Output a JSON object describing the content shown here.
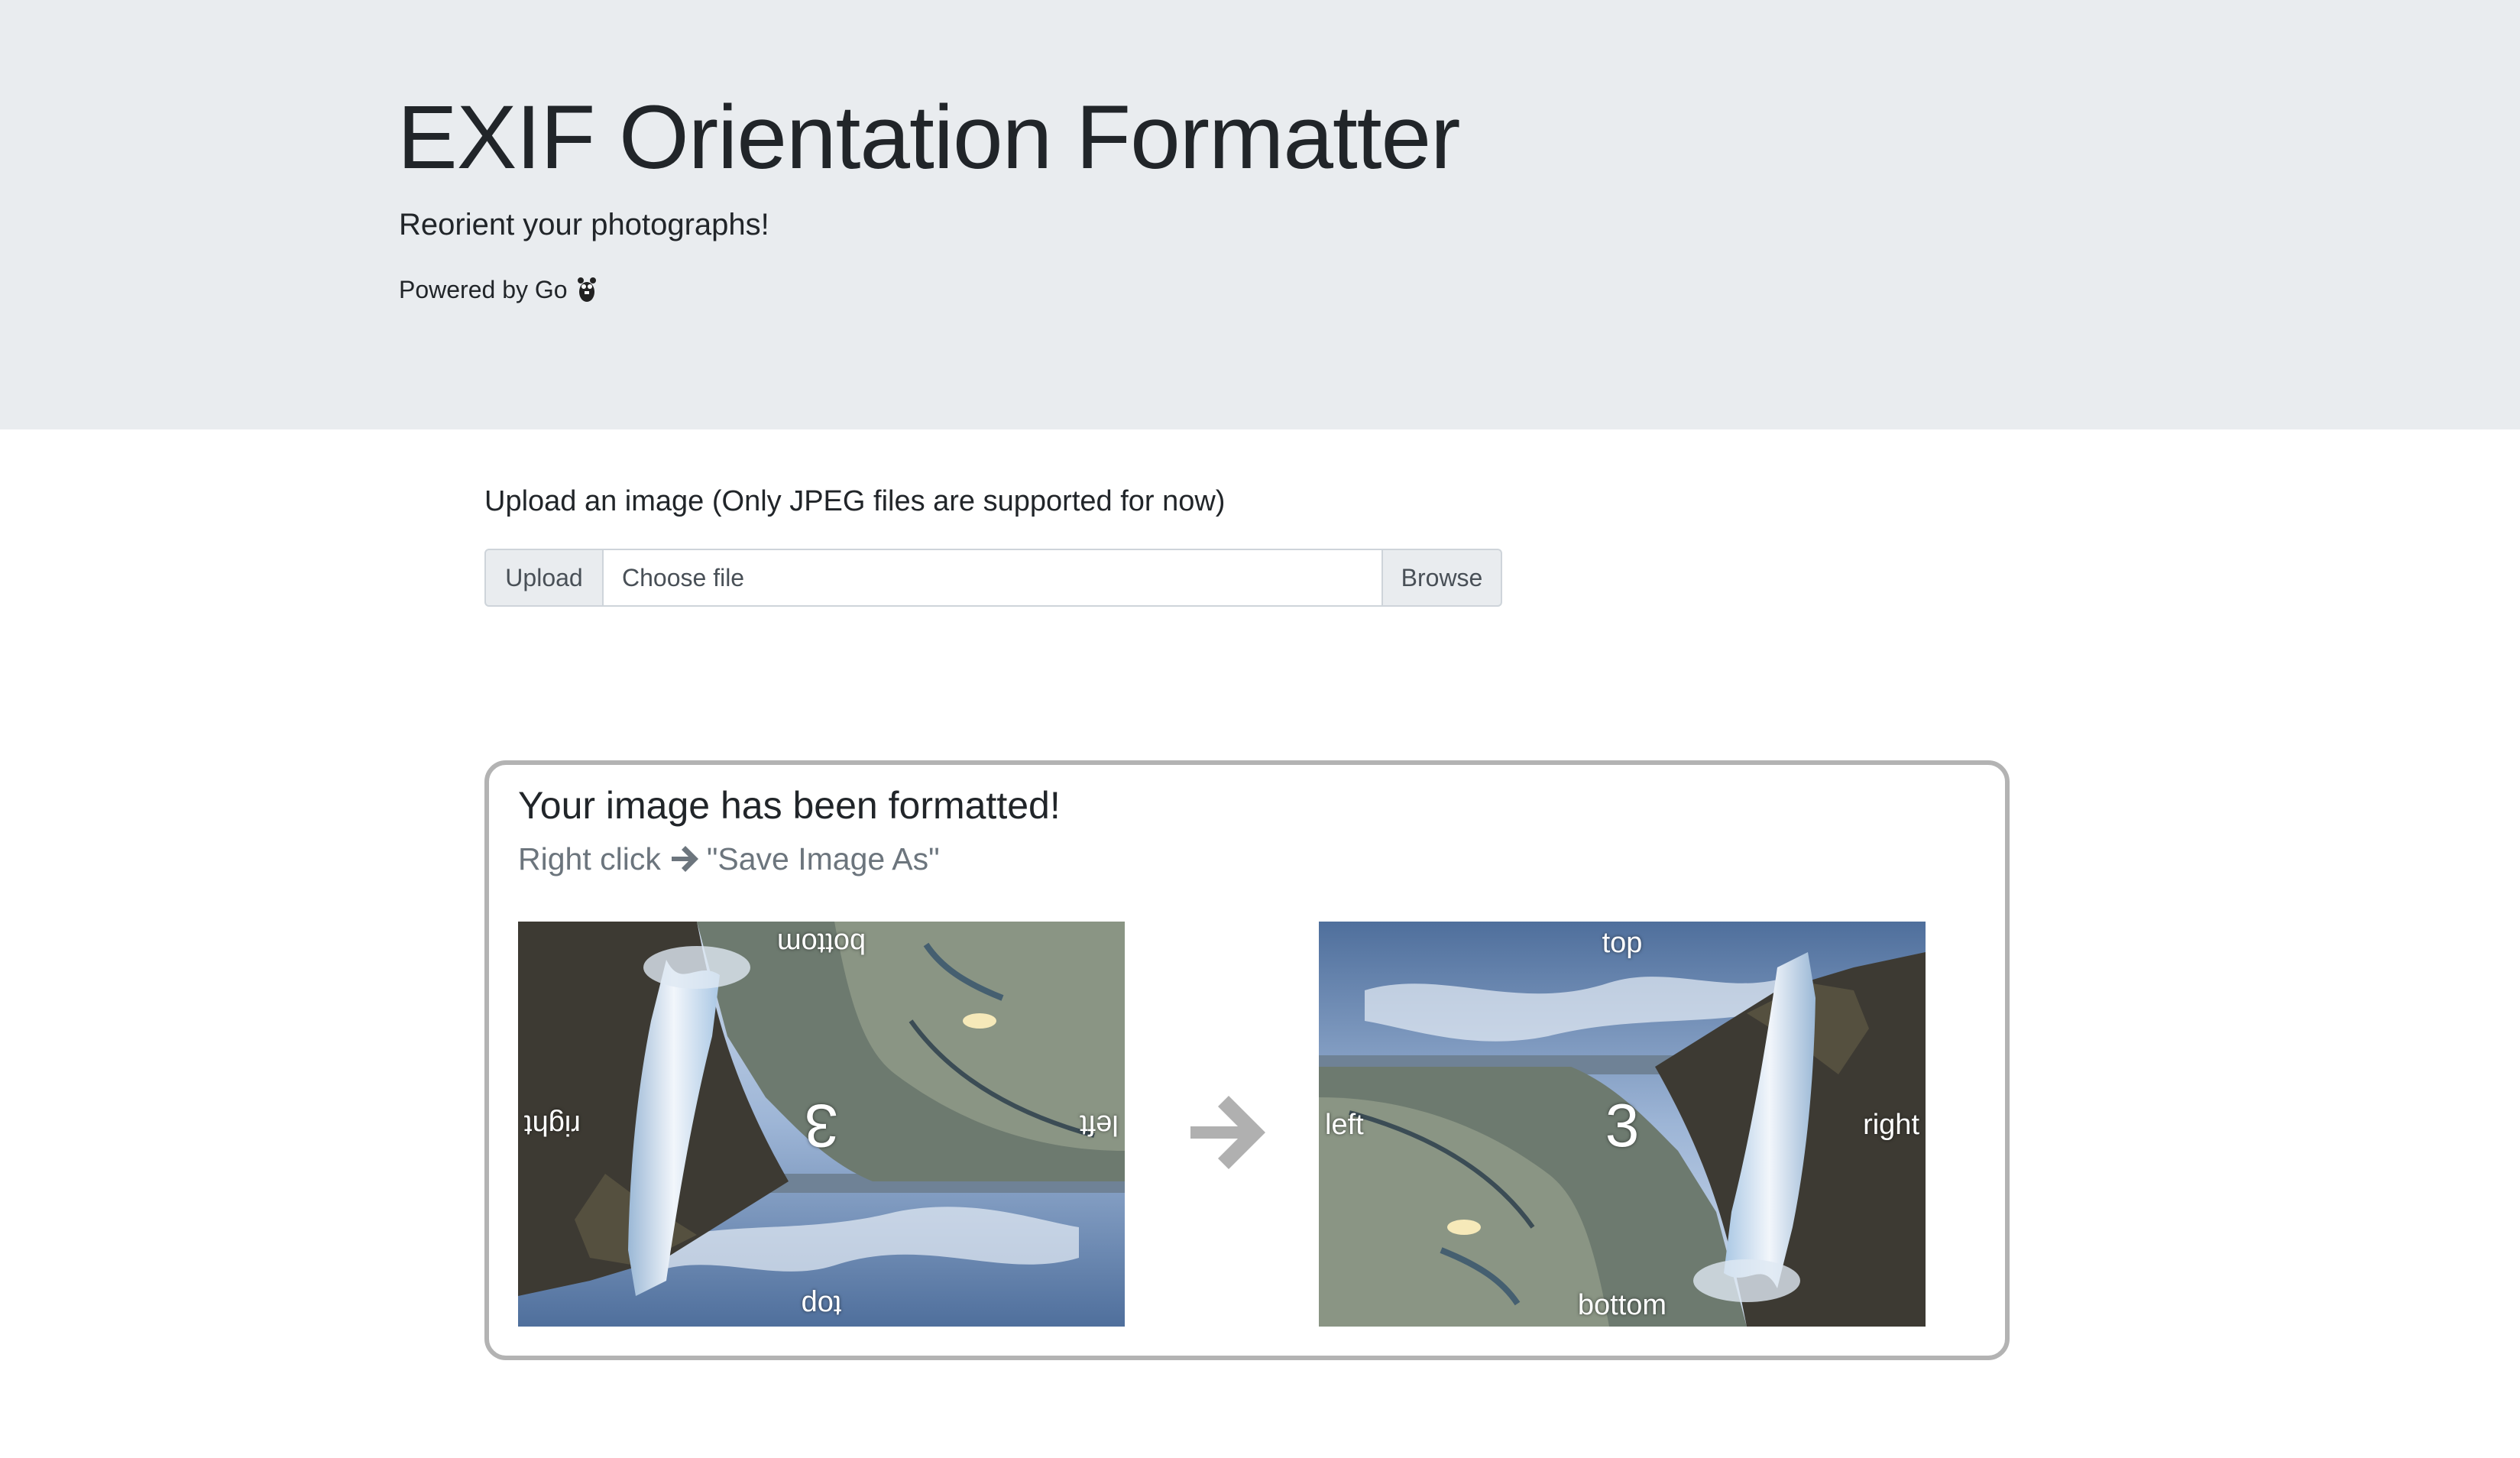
{
  "header": {
    "title": "EXIF Orientation Formatter",
    "lead": "Reorient your photographs!",
    "powered_by": "Powered by Go",
    "gopher_icon": "gopher-icon"
  },
  "upload": {
    "label": "Upload an image (Only JPEG files are supported for now)",
    "prepend_label": "Upload",
    "file_placeholder": "Choose file",
    "browse_label": "Browse"
  },
  "result": {
    "title": "Your image has been formatted!",
    "instruction_prefix": "Right click",
    "instruction_suffix": "\"Save Image As\"",
    "arrow_icon": "arrow-right-icon",
    "before_image": {
      "labels": {
        "top": "top",
        "bottom": "bottom",
        "left": "left",
        "right": "right",
        "center": "3"
      },
      "orientation": "rotated-180"
    },
    "after_image": {
      "labels": {
        "top": "top",
        "bottom": "bottom",
        "left": "left",
        "right": "right",
        "center": "3"
      },
      "orientation": "upright"
    }
  },
  "colors": {
    "jumbotron_bg": "#e9ecef",
    "card_border": "#b3b3b3",
    "muted_text": "#6c757d",
    "arrow_gray": "#b0b0b0"
  }
}
